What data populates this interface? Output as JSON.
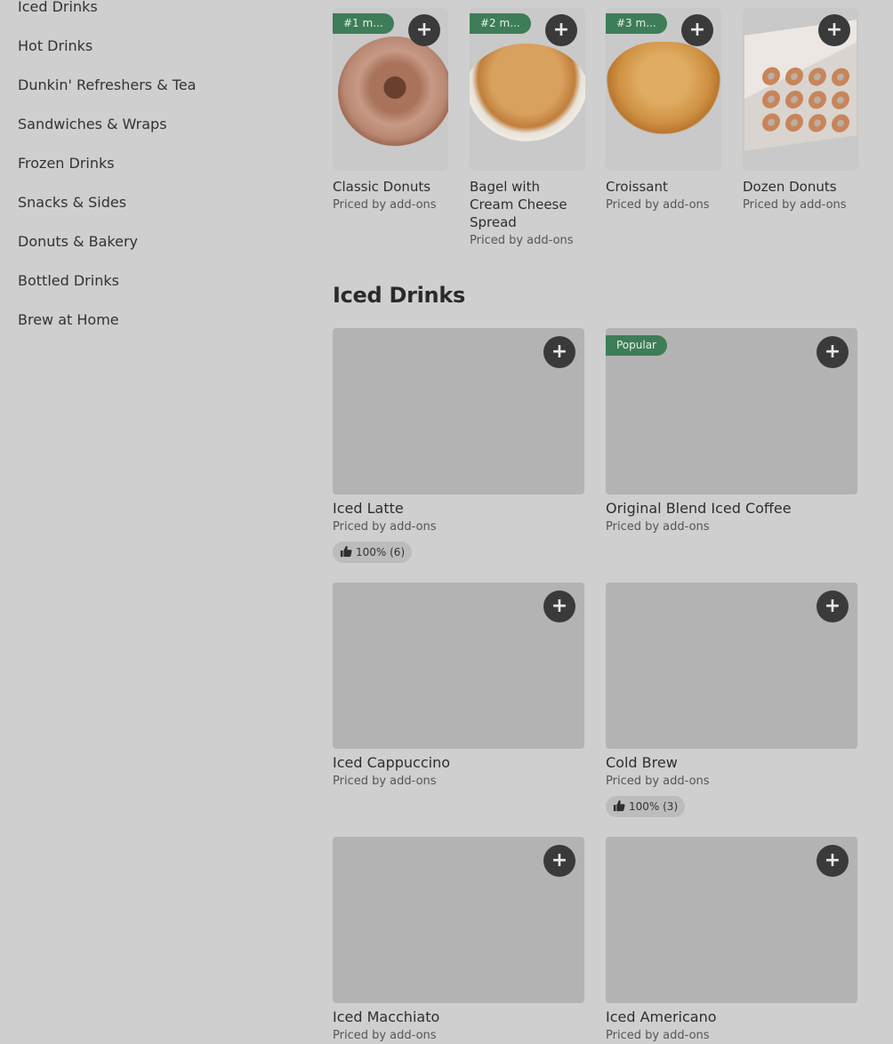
{
  "sidebar": {
    "items": [
      {
        "label": "Iced Drinks"
      },
      {
        "label": "Hot Drinks"
      },
      {
        "label": "Dunkin' Refreshers & Tea"
      },
      {
        "label": "Sandwiches & Wraps"
      },
      {
        "label": "Frozen Drinks"
      },
      {
        "label": "Snacks & Sides"
      },
      {
        "label": "Donuts & Bakery"
      },
      {
        "label": "Bottled Drinks"
      },
      {
        "label": "Brew at Home"
      }
    ]
  },
  "featured": [
    {
      "badge": "#1 m...",
      "name": "Classic Donuts",
      "sub": "Priced by add-ons",
      "add": "+"
    },
    {
      "badge": "#2 m...",
      "name": "Bagel with Cream Cheese Spread",
      "sub": "Priced by add-ons",
      "add": "+"
    },
    {
      "badge": "#3 m...",
      "name": "Croissant",
      "sub": "Priced by add-ons",
      "add": "+"
    },
    {
      "name": "Dozen Donuts",
      "sub": "Priced by add-ons",
      "add": "+"
    }
  ],
  "section": {
    "title": "Iced Drinks"
  },
  "items": [
    {
      "name": "Iced Latte",
      "sub": "Priced by add-ons",
      "rating": "100% (6)",
      "add": "+"
    },
    {
      "badge": "Popular",
      "name": "Original Blend Iced Coffee",
      "sub": "Priced by add-ons",
      "add": "+"
    },
    {
      "name": "Iced Cappuccino",
      "sub": "Priced by add-ons",
      "add": "+"
    },
    {
      "name": "Cold Brew",
      "sub": "Priced by add-ons",
      "rating": "100% (3)",
      "add": "+"
    },
    {
      "name": "Iced Macchiato",
      "sub": "Priced by add-ons",
      "add": "+"
    },
    {
      "name": "Iced Americano",
      "sub": "Priced by add-ons",
      "add": "+"
    }
  ],
  "colors": {
    "background": "#cfcfcf",
    "badge": "#3d7d57",
    "add_button": "#3a3a3a",
    "image_placeholder": "#b3b3b3"
  },
  "icons": {
    "add": "plus-icon",
    "rating": "thumbs-up-icon"
  }
}
